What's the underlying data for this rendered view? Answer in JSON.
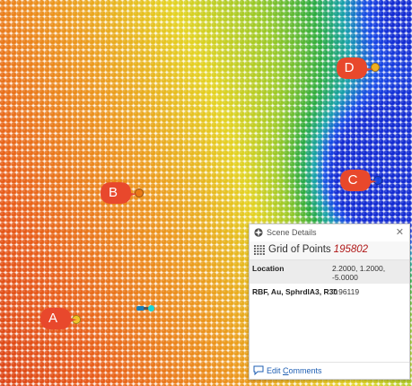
{
  "markers": [
    {
      "label": "A"
    },
    {
      "label": "B"
    },
    {
      "label": "C"
    },
    {
      "label": "D"
    }
  ],
  "icons": {
    "title": "scene-details-icon",
    "grid": "grid-of-points-icon",
    "close": "close-icon",
    "comment": "comment-icon"
  },
  "colors": {
    "marker": "#e8482c",
    "link": "#1f5fb3",
    "object_id": "#b01818"
  },
  "scene_details": {
    "title": "Scene Details",
    "close_glyph": "✕",
    "object_name": "Grid of Points",
    "object_id": "195802",
    "rows": [
      {
        "key": "Location",
        "value": "2.2000, 1.2000, -5.0000"
      },
      {
        "key": "RBF, Au, SphrdlA3, R30",
        "value": "7.96119"
      }
    ],
    "edit_prefix": "Edit ",
    "edit_accesskey": "C",
    "edit_rest": "omments"
  }
}
